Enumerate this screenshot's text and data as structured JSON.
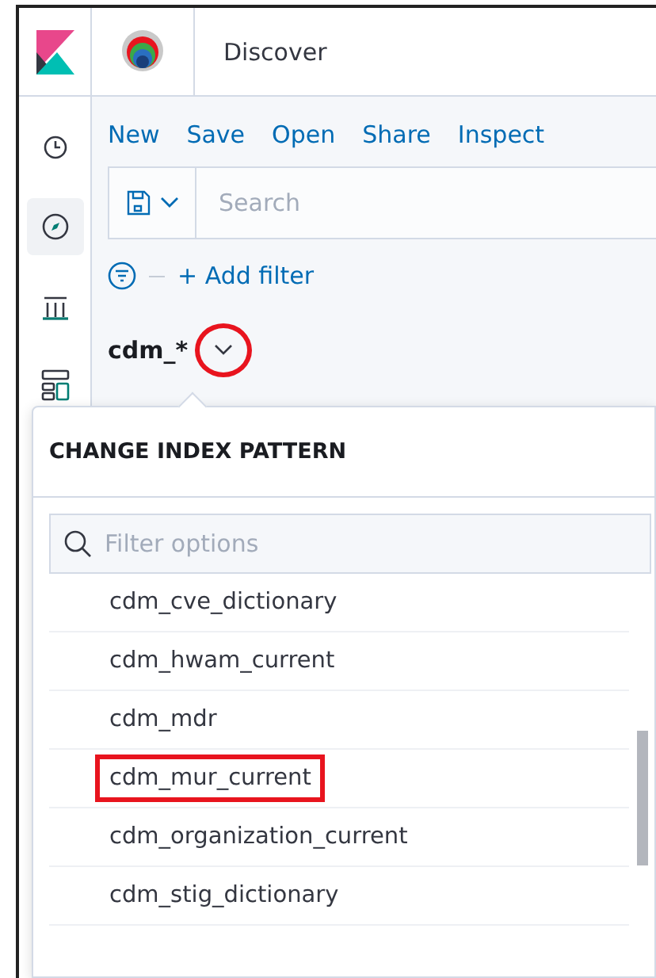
{
  "header": {
    "title": "Discover"
  },
  "nav": [
    {
      "kind": "clock",
      "selected": false
    },
    {
      "kind": "compass",
      "selected": true
    },
    {
      "kind": "chart",
      "selected": false
    },
    {
      "kind": "layout",
      "selected": false
    }
  ],
  "top_menu": [
    "New",
    "Save",
    "Open",
    "Share",
    "Inspect"
  ],
  "search": {
    "placeholder": "Search"
  },
  "filter_bar": {
    "add_filter": "+ Add filter"
  },
  "index_pattern": {
    "title": "cdm_*",
    "circled": true
  },
  "popover": {
    "title": "CHANGE INDEX PATTERN",
    "filter": {
      "placeholder": "Filter options"
    },
    "items": [
      {
        "label": "cdm_cve_dictionary",
        "highlighted": false
      },
      {
        "label": "cdm_hwam_current",
        "highlighted": false
      },
      {
        "label": "cdm_mdr",
        "highlighted": false
      },
      {
        "label": "cdm_mur_current",
        "highlighted": true
      },
      {
        "label": "cdm_organization_current",
        "highlighted": false
      },
      {
        "label": "cdm_stig_dictionary",
        "highlighted": false
      }
    ]
  }
}
